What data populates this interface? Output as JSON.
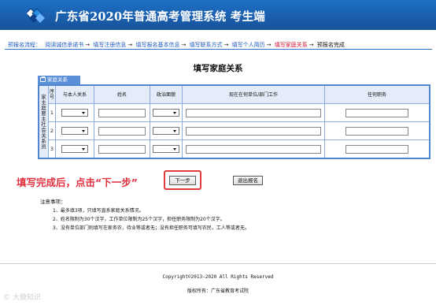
{
  "header": {
    "title": "广东省2020年普通高考管理系统 考生端"
  },
  "steps": {
    "label": "预报名流程：",
    "items": [
      "阅读诚信承诺书",
      "填写注册信息",
      "填写报名基本信息",
      "填写联系方式",
      "填写个人简历",
      "填写家庭关系",
      "预报名完成"
    ],
    "current_index": 5
  },
  "page_title": "填写家庭关系",
  "section_tab": "家庭关系",
  "table": {
    "side_label": "家主庭要主社会关系员",
    "headers": [
      "序号",
      "与本人关系",
      "姓名",
      "政治面貌",
      "现在在何单位/部门工作",
      "任何职务"
    ],
    "rows": [
      "1",
      "2",
      "3"
    ]
  },
  "hint": "填写完成后，点击“下一步”",
  "buttons": {
    "next": "下一步",
    "exit": "退出报名"
  },
  "notice": {
    "title": "注意事项：",
    "items": [
      "1、最多填3项，只填写直系家庭关系情况。",
      "2、姓名限制为30个汉字，工作单位限制为25个汉字，担任职务限制为20个汉字。",
      "3、没有单位部门则填写在家务农，待业等或者无；没有担任职务可填写农民，工人等或者无。"
    ]
  },
  "footer": {
    "copyright": "Copyright©2013-2020  All Rights Reserved",
    "owner": "版权所有：广东省教育考试院"
  },
  "watermark": "大做知识",
  "colors": {
    "header": "#1a5fae",
    "accent": "#d0102a",
    "tab": "#5b8fd8"
  }
}
